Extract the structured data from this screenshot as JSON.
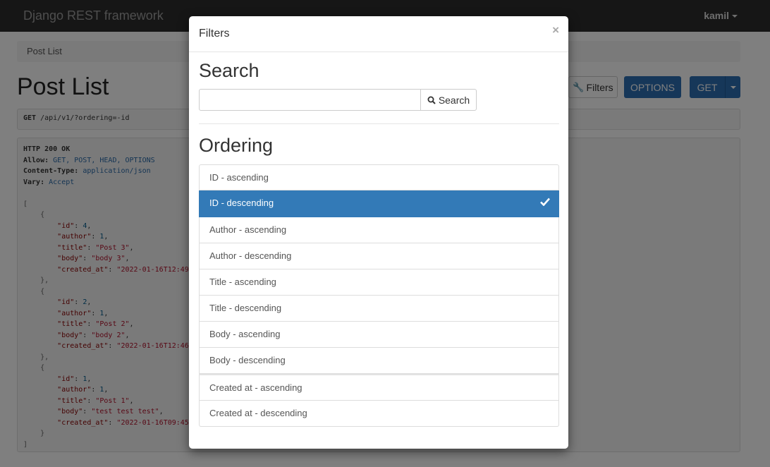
{
  "navbar": {
    "brand": "Django REST framework",
    "user": "kamil"
  },
  "breadcrumb": {
    "label": "Post List"
  },
  "page": {
    "title": "Post List"
  },
  "actions": {
    "filters_label": "Filters",
    "options_label": "OPTIONS",
    "get_label": "GET"
  },
  "request": {
    "method": "GET",
    "path": "/api/v1/?ordering=-id"
  },
  "response": {
    "status": "HTTP 200 OK",
    "headers": [
      {
        "name": "Allow:",
        "value": "GET, POST, HEAD, OPTIONS"
      },
      {
        "name": "Content-Type:",
        "value": "application/json"
      },
      {
        "name": "Vary:",
        "value": "Accept"
      }
    ],
    "posts": [
      {
        "id": "4",
        "author": "1",
        "title": "\"Post 3\"",
        "body": "\"body 3\"",
        "created_at": "\"2022-01-16T12:49:"
      },
      {
        "id": "2",
        "author": "1",
        "title": "\"Post 2\"",
        "body": "\"body 2\"",
        "created_at": "\"2022-01-16T12:46:"
      },
      {
        "id": "1",
        "author": "1",
        "title": "\"Post 1\"",
        "body": "\"test test test\"",
        "created_at": "\"2022-01-16T09:45:"
      }
    ]
  },
  "modal": {
    "title": "Filters",
    "close": "×",
    "search_heading": "Search",
    "search_value": "",
    "search_button": "Search",
    "ordering_heading": "Ordering",
    "ordering_options": [
      {
        "label": "ID - ascending",
        "active": false
      },
      {
        "label": "ID - descending",
        "active": true
      },
      {
        "label": "Author - ascending",
        "active": false
      },
      {
        "label": "Author - descending",
        "active": false
      },
      {
        "label": "Title - ascending",
        "active": false
      },
      {
        "label": "Title - descending",
        "active": false
      },
      {
        "label": "Body - ascending",
        "active": false
      },
      {
        "label": "Body - descending",
        "active": false
      },
      {
        "label": "Created at - ascending",
        "active": false
      },
      {
        "label": "Created at - descending",
        "active": false
      }
    ]
  },
  "colors": {
    "primary": "#337ab7",
    "navbar": "#2c2c2c"
  },
  "icons": {
    "filters": "wrench-icon",
    "search": "search-icon",
    "selected": "check-icon"
  }
}
